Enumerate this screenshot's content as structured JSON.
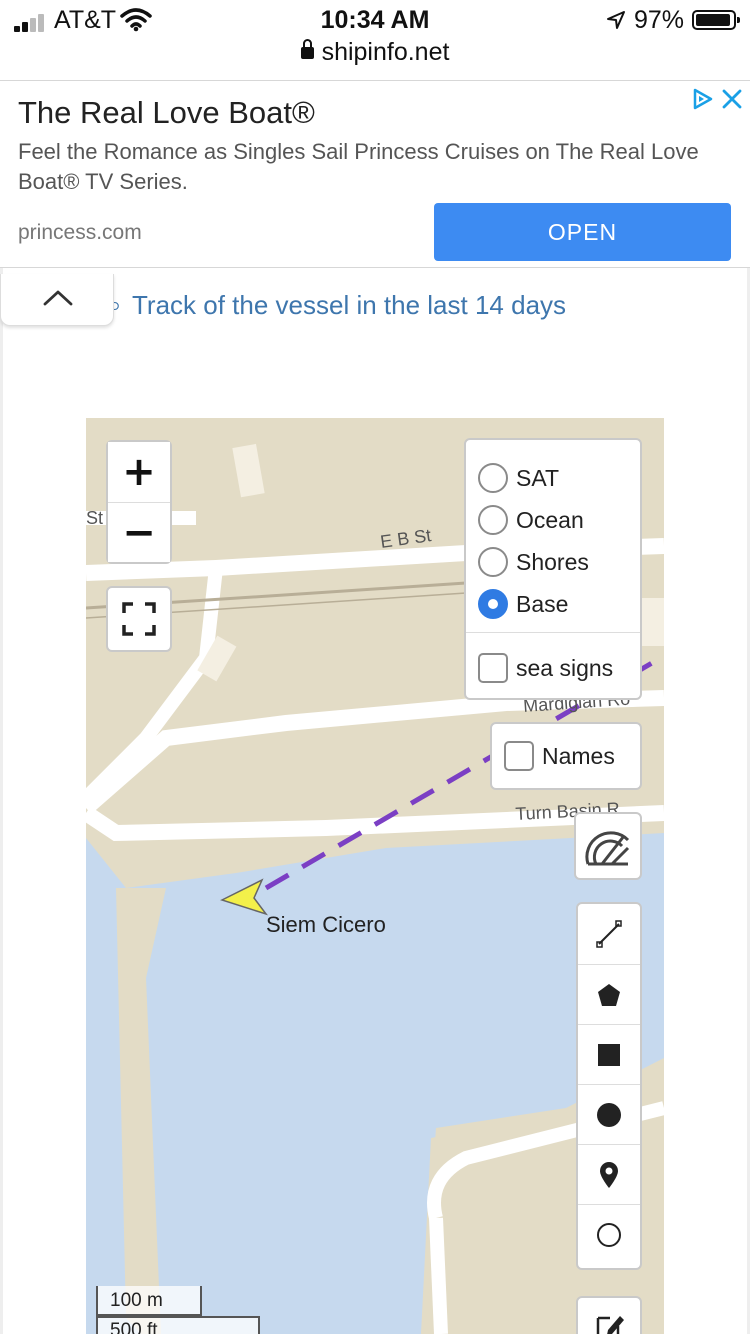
{
  "status_bar": {
    "carrier": "AT&T",
    "time": "10:34 AM",
    "battery_pct": "97%",
    "url": "shipinfo.net",
    "signal_bars": 2
  },
  "ad": {
    "title": "The Real Love Boat®",
    "description": "Feel the Romance as Singles Sail Princess Cruises on The Real Love Boat® TV Series.",
    "domain": "princess.com",
    "open_label": "OPEN",
    "accent_color": "#3d8bf2"
  },
  "page": {
    "track_title": "Track of the vessel in the last 14 days"
  },
  "map": {
    "zoom_in": "+",
    "zoom_out": "−",
    "layers": [
      {
        "label": "SAT",
        "selected": false
      },
      {
        "label": "Ocean",
        "selected": false
      },
      {
        "label": "Shores",
        "selected": false
      },
      {
        "label": "Base",
        "selected": true
      }
    ],
    "sea_signs_label": "sea signs",
    "names_label": "Names",
    "vessel_name": "Siem Cicero",
    "roads": [
      "E B St",
      "St",
      "Mardigian Ro",
      "Turn Basin R"
    ],
    "scale_metric": "100 m",
    "scale_imperial": "500 ft",
    "track_color": "#7b3fc4",
    "vessel_color": "#f3f04a",
    "water_color": "#c6d9ee",
    "land_color": "#e3dcc6",
    "draw_tools": [
      "line-icon",
      "polygon-icon",
      "rectangle-icon",
      "circle-icon",
      "marker-icon",
      "circle-marker-icon"
    ]
  }
}
